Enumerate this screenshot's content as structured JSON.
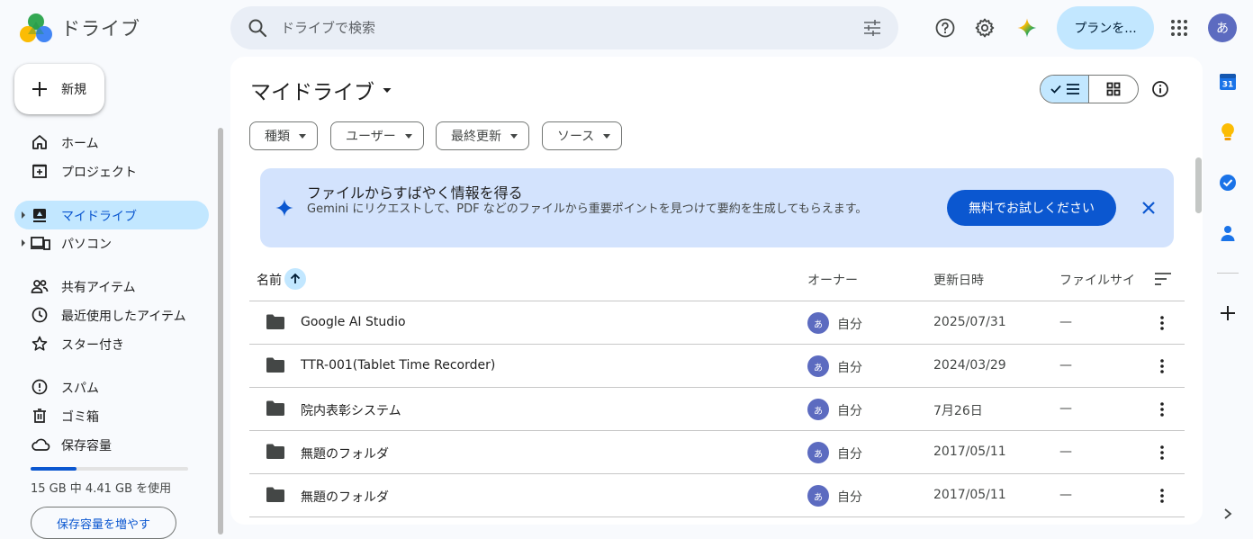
{
  "header": {
    "app_title": "ドライブ",
    "search_placeholder": "ドライブで検索",
    "plan_button": "プランを...",
    "avatar_letter": "あ"
  },
  "sidebar": {
    "new_button": "新規",
    "items": [
      {
        "label": "ホーム",
        "icon": "home-icon"
      },
      {
        "label": "プロジェクト",
        "icon": "project-icon"
      },
      {
        "label": "マイドライブ",
        "icon": "my-drive-icon",
        "active": true
      },
      {
        "label": "パソコン",
        "icon": "computer-icon"
      },
      {
        "label": "共有アイテム",
        "icon": "shared-icon"
      },
      {
        "label": "最近使用したアイテム",
        "icon": "clock-icon"
      },
      {
        "label": "スター付き",
        "icon": "star-icon"
      },
      {
        "label": "スパム",
        "icon": "spam-icon"
      },
      {
        "label": "ゴミ箱",
        "icon": "trash-icon"
      },
      {
        "label": "保存容量",
        "icon": "cloud-icon"
      }
    ],
    "storage": {
      "used_fraction": 0.294,
      "text": "15 GB 中 4.41 GB を使用",
      "button": "保存容量を増やす"
    }
  },
  "main": {
    "title": "マイドライブ",
    "filters": [
      "種類",
      "ユーザー",
      "最終更新",
      "ソース"
    ],
    "banner": {
      "title": "ファイルからすばやく情報を得る",
      "description": "Gemini にリクエストして、PDF などのファイルから重要ポイントを見つけて要約を生成してもらえます。",
      "button": "無料でお試しください"
    },
    "columns": {
      "name": "名前",
      "owner": "オーナー",
      "modified": "更新日時",
      "size": "ファイルサイ"
    },
    "rows": [
      {
        "name": "Google AI Studio",
        "owner": "自分",
        "owner_avatar": "あ",
        "date": "2025/07/31",
        "size": "—"
      },
      {
        "name": "TTR-001(Tablet Time Recorder)",
        "owner": "自分",
        "owner_avatar": "あ",
        "date": "2024/03/29",
        "size": "—"
      },
      {
        "name": "院内表彰システム",
        "owner": "自分",
        "owner_avatar": "あ",
        "date": "7月26日",
        "size": "—"
      },
      {
        "name": "無題のフォルダ",
        "owner": "自分",
        "owner_avatar": "あ",
        "date": "2017/05/11",
        "size": "—"
      },
      {
        "name": "無題のフォルダ",
        "owner": "自分",
        "owner_avatar": "あ",
        "date": "2017/05/11",
        "size": "—"
      }
    ]
  },
  "rail": {
    "calendar_day": "31"
  },
  "colors": {
    "accent": "#0b57d0",
    "active_bg": "#c2e7ff",
    "banner_bg": "#d3e3fd",
    "search_bg": "#e9eef6"
  }
}
